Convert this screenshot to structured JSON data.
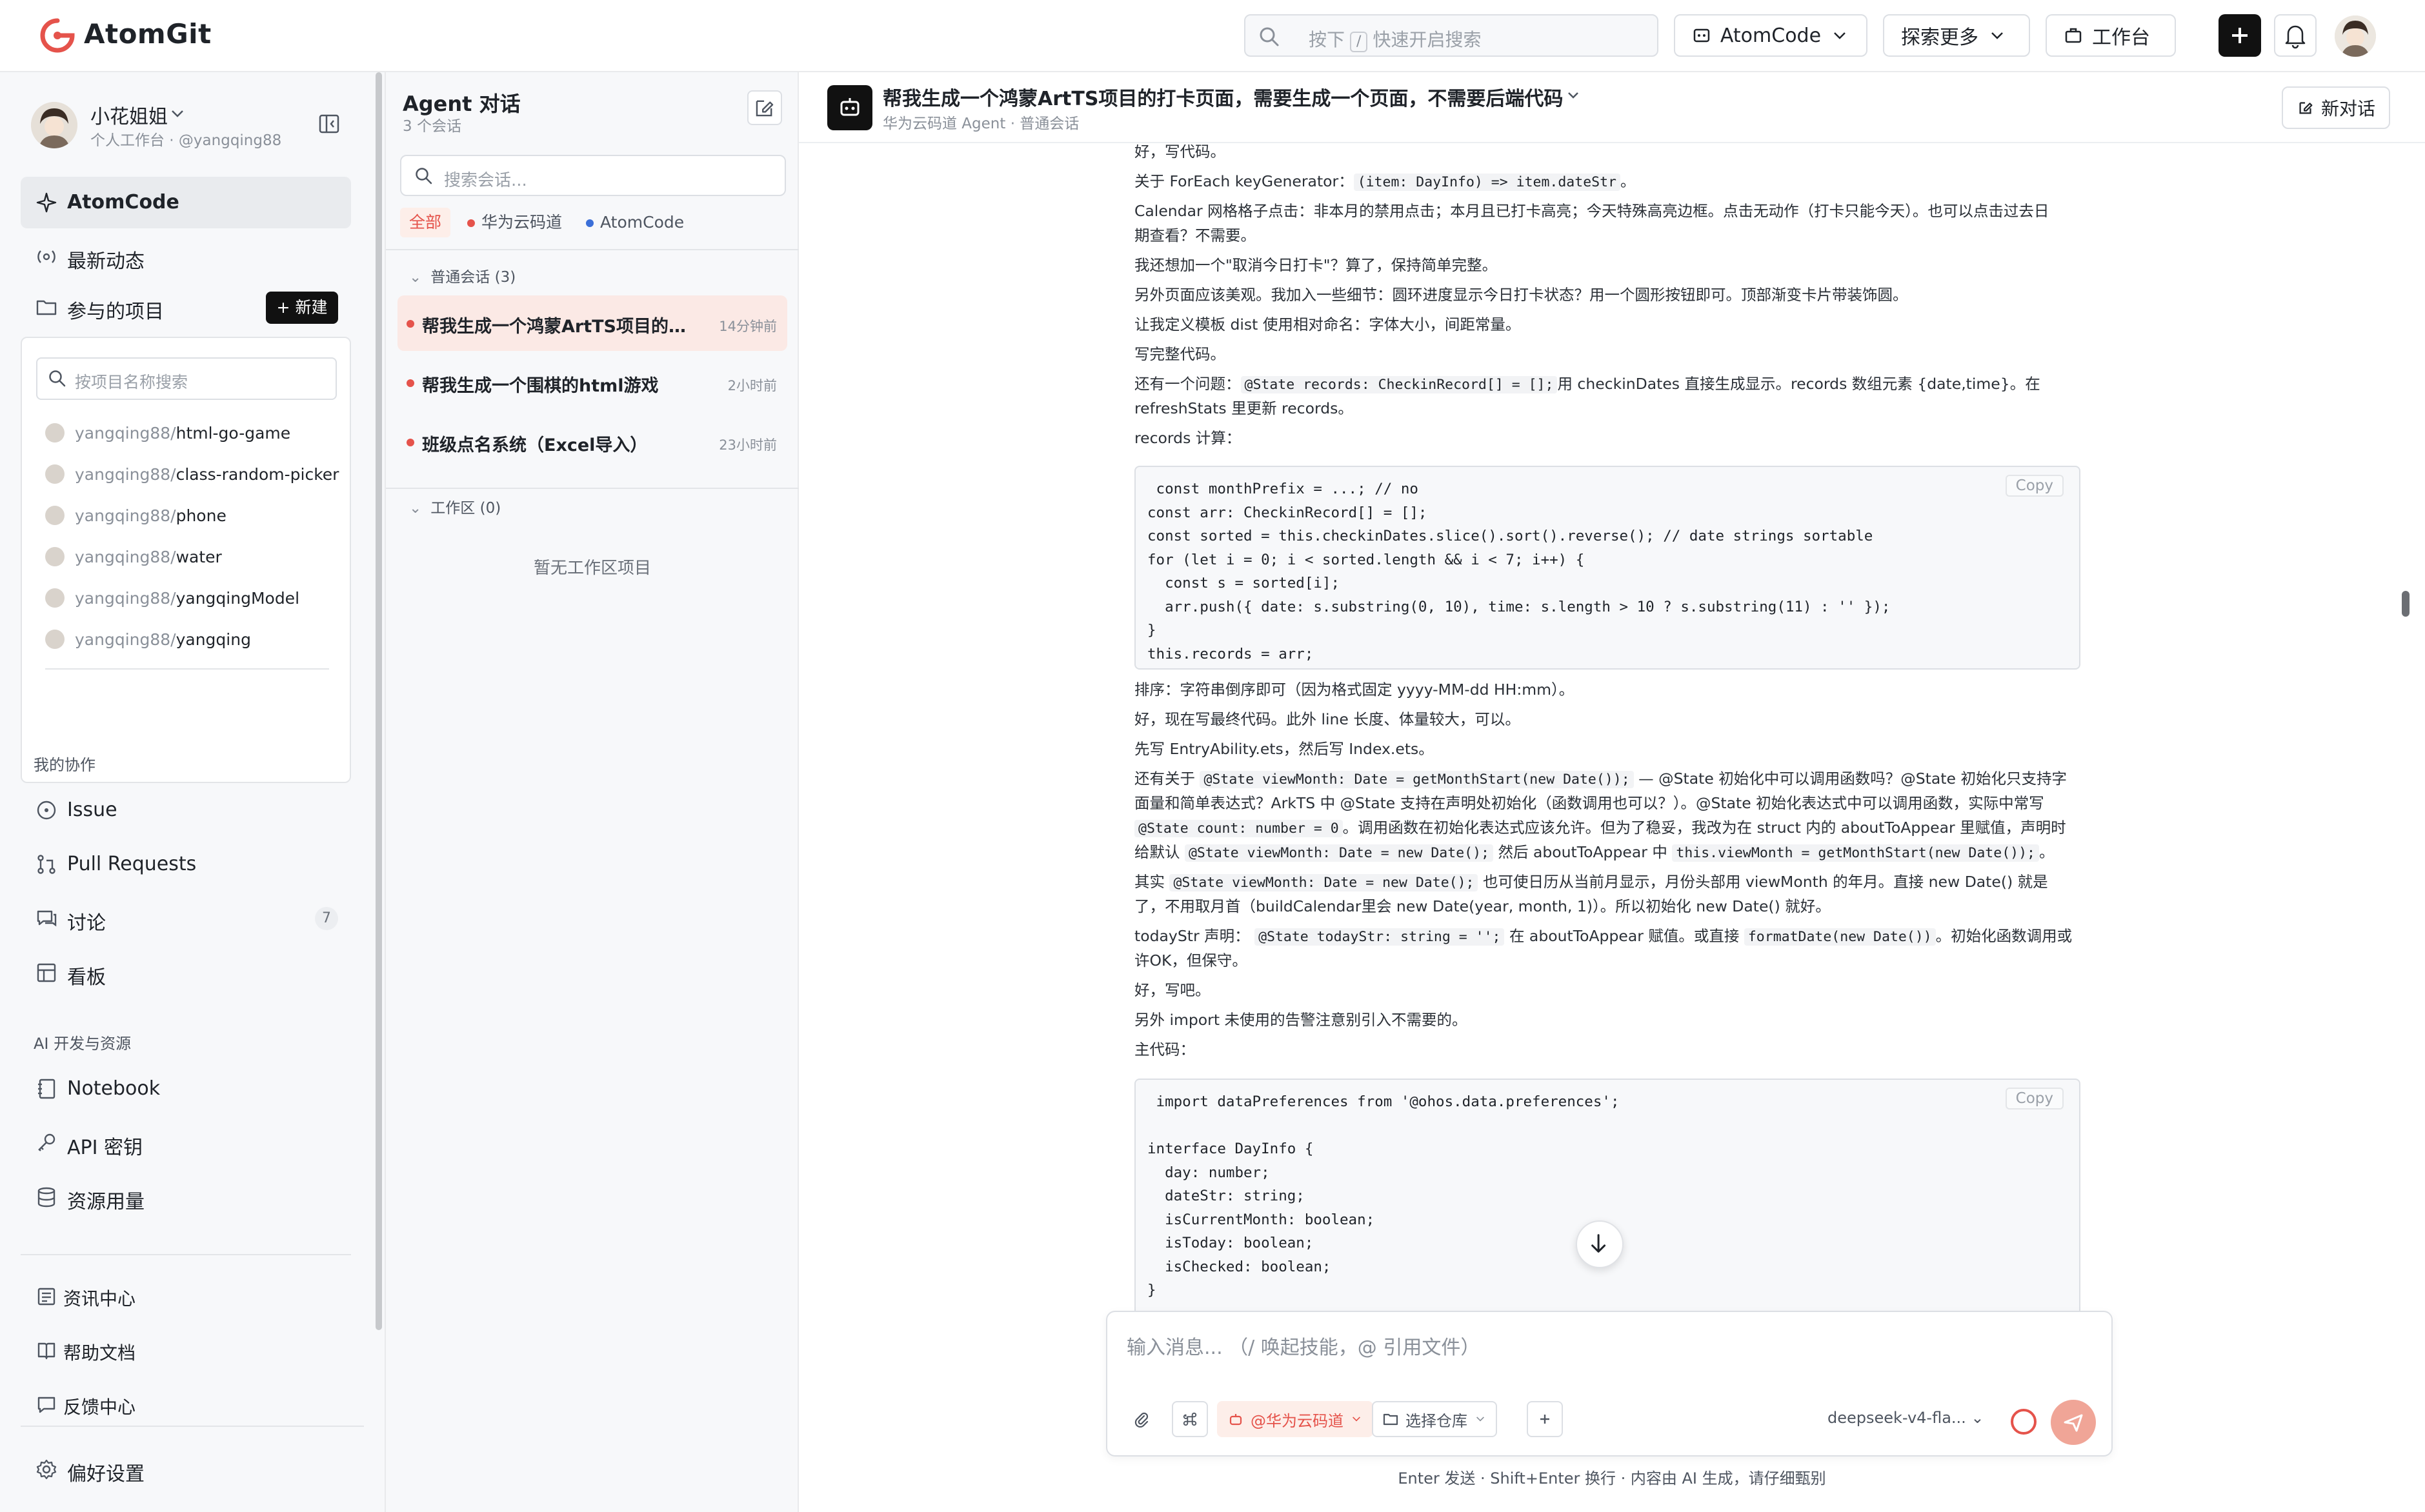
{
  "brand": {
    "name": "AtomGit",
    "color": "#e5534b"
  },
  "topbar": {
    "search_placeholder_pre": "按下",
    "search_key": "/",
    "search_placeholder_post": "快速开启搜索",
    "atomcode_label": "AtomCode",
    "explore_label": "探索更多",
    "workbench_label": "工作台"
  },
  "user": {
    "name": "小花姐姐",
    "sub": "个人工作台 · @yangqing88"
  },
  "nav": {
    "atomcode": "AtomCode",
    "news": "最新动态",
    "projects": "参与的项目",
    "new_button": "+ 新建",
    "project_search_placeholder": "按项目名称搜索",
    "collab_section": "我的协作",
    "issue": "Issue",
    "pull_requests": "Pull Requests",
    "discussion": "讨论",
    "discussion_count": "7",
    "board": "看板",
    "ai_section": "AI 开发与资源",
    "notebook": "Notebook",
    "api_key": "API 密钥",
    "usage": "资源用量",
    "info_center": "资讯中心",
    "help_docs": "帮助文档",
    "feedback": "反馈中心",
    "preferences": "偏好设置"
  },
  "projects": [
    {
      "owner": "yangqing88/",
      "name": "html-go-game"
    },
    {
      "owner": "yangqing88/",
      "name": "class-random-picker"
    },
    {
      "owner": "yangqing88/",
      "name": "phone"
    },
    {
      "owner": "yangqing88/",
      "name": "water"
    },
    {
      "owner": "yangqing88/",
      "name": "yangqingModel"
    },
    {
      "owner": "yangqing88/",
      "name": "yangqing"
    }
  ],
  "conversations": {
    "title": "Agent 对话",
    "count": "3 个会话",
    "search_placeholder": "搜索会话...",
    "filters": [
      "全部",
      "华为云码道",
      "AtomCode"
    ],
    "filter_colors": [
      "#e5534b",
      "#e5534b",
      "#3b6fd8"
    ],
    "group_normal": "普通会话",
    "group_normal_count": "(3)",
    "group_workspace": "工作区",
    "group_workspace_count": "(0)",
    "empty_workspace": "暂无工作区项目",
    "items": [
      {
        "title": "帮我生成一个鸿蒙ArtTS项目的打卡...",
        "time": "14分钟前"
      },
      {
        "title": "帮我生成一个围棋的html游戏",
        "time": "2小时前"
      },
      {
        "title": "班级点名系统（Excel导入）",
        "time": "23小时前"
      }
    ]
  },
  "main": {
    "title": "帮我生成一个鸿蒙ArtTS项目的打卡页面，需要生成一个页面，不需要后端代码",
    "subtitle": "华为云码道 Agent · 普通会话",
    "new_chat": "新对话",
    "copy_label": "Copy",
    "lines": {
      "l1": "好，写代码。",
      "l2a": "关于 ForEach keyGenerator：",
      "l2c": "(item: DayInfo) => item.dateStr",
      "l2b": "。",
      "l3": "Calendar 网格格子点击：非本月的禁用点击；本月且已打卡高亮；今天特殊高亮边框。点击无动作（打卡只能今天）。也可以点击过去日",
      "l3b": "期查看？不需要。",
      "l4": "我还想加一个\"取消今日打卡\"？算了，保持简单完整。",
      "l5": "另外页面应该美观。我加入一些细节：圆环进度显示今日打卡状态？用一个圆形按钮即可。顶部渐变卡片带装饰圆。",
      "l6": "让我定义模板 dist 使用相对命名：字体大小，间距常量。",
      "l7": "写完整代码。",
      "l8a": "还有一个问题：",
      "l8c": "@State records: CheckinRecord[] = [];",
      "l8b": "用 checkinDates 直接生成显示。records 数组元素 {date,time}。在",
      "l8d": "refreshStats 里更新 records。",
      "l9": "records 计算：",
      "l10": "排序：字符串倒序即可（因为格式固定 yyyy-MM-dd HH:mm）。",
      "l11": "好，现在写最终代码。此外 line 长度、体量较大，可以。",
      "l12": "先写 EntryAbility.ets，然后写 Index.ets。",
      "l13a": "还有关于",
      "l13c": "@State viewMonth: Date = getMonthStart(new Date());",
      "l13b": "— @State 初始化中可以调用函数吗？@State 初始化只支持字",
      "l14": "面量和简单表达式？ArkTS 中 @State 支持在声明处初始化（函数调用也可以？）。@State 初始化表达式中可以调用函数，实际中常写",
      "l15c": "@State count: number = 0",
      "l15b": "。调用函数在初始化表达式应该允许。但为了稳妥，我改为在 struct 内的 aboutToAppear 里赋值，声明时",
      "l16a": "给默认",
      "l16c": "@State viewMonth: Date = new Date();",
      "l16b": "然后 aboutToAppear 中",
      "l16d": "this.viewMonth = getMonthStart(new Date());",
      "l16e": "。",
      "l17a": "其实",
      "l17c": "@State viewMonth: Date = new Date();",
      "l17b": "也可使日历从当前月显示，月份头部用 viewMonth 的年月。直接 new Date() 就是",
      "l18": "了，不用取月首（buildCalendar里会 new Date(year, month, 1)）。所以初始化 new Date() 就好。",
      "l19a": "todayStr 声明：",
      "l19c": "@State todayStr: string = '';",
      "l19b": "在 aboutToAppear 赋值。或直接",
      "l19d": "formatDate(new Date())",
      "l19e": "。初始化函数调用或",
      "l20": "许OK，但保守。",
      "l21": "好，写吧。",
      "l22": "另外 import 未使用的告警注意别引入不需要的。",
      "l23": "主代码："
    },
    "code1": " const monthPrefix = ...; // no\nconst arr: CheckinRecord[] = [];\nconst sorted = this.checkinDates.slice().sort().reverse(); // date strings sortable\nfor (let i = 0; i < sorted.length && i < 7; i++) {\n  const s = sorted[i];\n  arr.push({ date: s.substring(0, 10), time: s.length > 10 ? s.substring(11) : '' });\n}\nthis.records = arr;",
    "code2": " import dataPreferences from '@ohos.data.preferences';\n\ninterface DayInfo {\n  day: number;\n  dateStr: string;\n  isCurrentMonth: boolean;\n  isToday: boolean;\n  isChecked: boolean;\n}"
  },
  "composer": {
    "placeholder": "输入消息...  （/ 唤起技能，@ 引用文件）",
    "platform": "@华为云码道",
    "repo": "选择仓库",
    "model": "deepseek-v4-fla...",
    "footnote": "Enter 发送 · Shift+Enter 换行 · 内容由 AI 生成，请仔细甄别"
  }
}
